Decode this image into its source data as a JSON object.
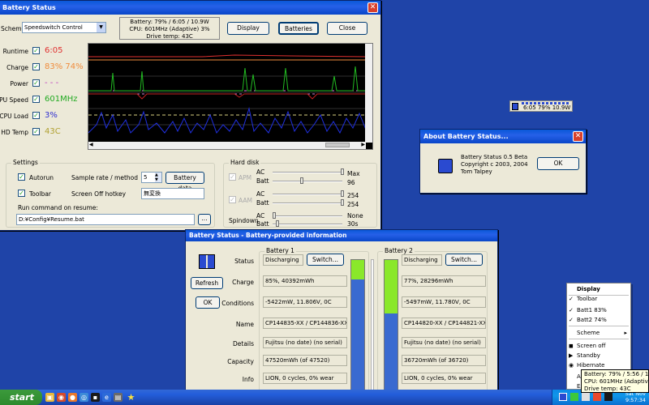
{
  "main_window": {
    "title": "Battery Status",
    "scheme_label": "Scheme",
    "scheme_value": "Speedswitch Control",
    "status_lines": [
      "Battery: 79% / 6:05 / 10.9W",
      "CPU: 601MHz (Adaptive) 3%",
      "Drive temp: 43C"
    ],
    "buttons": {
      "display": "Display",
      "batteries": "Batteries",
      "close": "Close"
    },
    "metrics": [
      {
        "label": "Runtime",
        "value": "6:05",
        "color": "#e03030"
      },
      {
        "label": "Charge",
        "value": "83% 74%",
        "color": "#f08c3c"
      },
      {
        "label": "Power",
        "value": "- - -",
        "color": "#c040c0"
      },
      {
        "label": "CPU Speed",
        "value": "601MHz",
        "color": "#22aa22"
      },
      {
        "label": "CPU Load",
        "value": "3%",
        "color": "#3030d0"
      },
      {
        "label": "HD Temp",
        "value": "43C",
        "color": "#b0a030"
      }
    ],
    "settings": {
      "title": "Settings",
      "autorun": "Autorun",
      "toolbar": "Toolbar",
      "sample_rate_label": "Sample rate / method",
      "sample_rate_value": "5",
      "battery_data_button": "Battery data",
      "screen_off_label": "Screen Off hotkey",
      "screen_off_value": "無変換",
      "run_command_label": "Run command on resume:",
      "run_command_value": "D:¥Config¥Resume.bat",
      "browse_button": "..."
    },
    "hard_disk": {
      "title": "Hard disk",
      "apm": "APM",
      "aam": "AAM",
      "spindown": "Spindown",
      "ac": "AC",
      "batt": "Batt",
      "apm_ac_value": "Max",
      "apm_batt_value": "96",
      "aam_ac_value": "254",
      "aam_batt_value": "254",
      "spindown_ac_value": "None",
      "spindown_batt_value": "30s"
    }
  },
  "about_window": {
    "title": "About Battery Status...",
    "line1": "Battery Status 0.5 Beta",
    "line2": "Copyright c 2003, 2004",
    "line3": "Tom Talpey",
    "ok": "OK"
  },
  "desktop_toolbar": {
    "text": "6:05 79% 10.9W"
  },
  "batt_info_window": {
    "title": "Battery Status - Battery-provided information",
    "refresh": "Refresh",
    "ok": "OK",
    "row_labels": [
      "Status",
      "Charge",
      "Conditions",
      "Name",
      "Details",
      "Capacity",
      "Info"
    ],
    "switch_label": "Switch...",
    "battery1": {
      "title": "Battery 1",
      "status": "Discharging",
      "charge": "85%, 40392mWh",
      "conditions": "-5422mW, 11.806V, 0C",
      "name": "CP144835-XX / CP144836-XX",
      "details": "Fujitsu (no date) (no serial)",
      "capacity": "47520mWh (of 47520)",
      "info": "LION, 0 cycles, 0% wear",
      "level": 0.85
    },
    "battery2": {
      "title": "Battery 2",
      "status": "Discharging",
      "charge": "77%, 28296mWh",
      "conditions": "-5497mW, 11.780V, 0C",
      "name": "CP144820-XX / CP144821-XX",
      "details": "Fujitsu (no date) (no serial)",
      "capacity": "36720mWh (of 36720)",
      "info": "LION, 0 cycles, 0% wear",
      "level": 0.77
    }
  },
  "context_menu": {
    "items": [
      "Display",
      "Toolbar",
      "Batt1 83%",
      "Batt2 74%",
      "Scheme",
      "Screen off",
      "Standby",
      "Hibernate",
      "Al",
      "Ex"
    ]
  },
  "tray_tooltip": {
    "lines": [
      "Battery: 79% / 5:56 / 11.",
      "CPU: 601MHz (Adaptive) 3%",
      "Drive temp: 43C"
    ]
  },
  "taskbar": {
    "start": "start",
    "clock_day": "Sat Nov",
    "clock_time": "9:57:34"
  }
}
